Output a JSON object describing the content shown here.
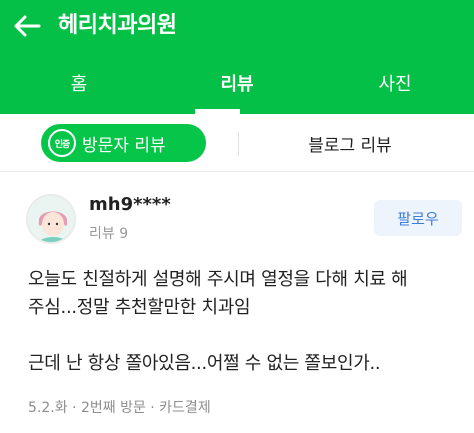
{
  "header": {
    "title": "헤리치과의원",
    "back_icon": "arrow-left-icon"
  },
  "tabs": [
    {
      "label": "홈",
      "active": false
    },
    {
      "label": "리뷰",
      "active": true
    },
    {
      "label": "사진",
      "active": false
    }
  ],
  "subtabs": {
    "visitor_badge": "인증",
    "visitor_label": "방문자 리뷰",
    "blog_label": "블로그 리뷰"
  },
  "review": {
    "user_name": "mh9****",
    "review_count": "리뷰 9",
    "follow_label": "팔로우",
    "body_lines": [
      "오늘도 친절하게 설명해 주시며 열정을 다해 치료 해",
      "주심...정말 추천할만한 치과임",
      "근데 난 항상 쫄아있음...어쩔 수 없는 쫄보인가.."
    ],
    "meta": "5.2.화 · 2번째 방문 · 카드결제"
  },
  "colors": {
    "brand_green": "#05c046",
    "follow_text": "#3d7dd8",
    "follow_bg": "#eef4fb"
  }
}
